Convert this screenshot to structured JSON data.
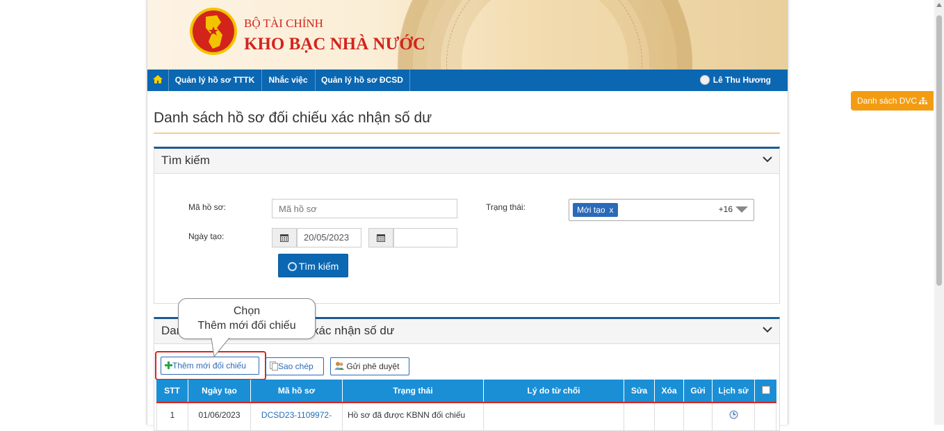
{
  "banner": {
    "ministry": "BỘ TÀI CHÍNH",
    "agency": "KHO BẠC NHÀ NƯỚC"
  },
  "nav": {
    "items": [
      {
        "label": "Quản lý hồ sơ TTTK"
      },
      {
        "label": "Nhắc việc"
      },
      {
        "label": "Quản lý hồ sơ ĐCSD"
      }
    ],
    "user": "Lê Thu Hương"
  },
  "page_title": "Danh sách hồ sơ đối chiếu xác nhận số dư",
  "search": {
    "panel_title": "Tìm kiếm",
    "code_label": "Mã hồ sơ:",
    "code_placeholder": "Mã hồ sơ",
    "status_label": "Trạng thái:",
    "status_tag": "Mới tạo",
    "status_tag_remove": "x",
    "status_more": "+16",
    "date_label": "Ngày tạo:",
    "date_from": "20/05/2023",
    "date_to": "",
    "search_button": "Tìm kiếm"
  },
  "list": {
    "panel_title": "Danh sách hồ sơ đối chiếu xác nhận số dư",
    "panel_title_visible_start": "Dan",
    "panel_title_visible_end": "xác nhận số dư",
    "buttons": {
      "add": "Thêm mới đối chiếu",
      "copy": "Sao chép",
      "send": "Gửi phê duyệt"
    },
    "columns": [
      "STT",
      "Ngày tạo",
      "Mã hồ sơ",
      "Trạng thái",
      "Lý do từ chối",
      "Sửa",
      "Xóa",
      "Gửi",
      "Lịch sử"
    ],
    "rows": [
      {
        "stt": "1",
        "date": "01/06/2023",
        "code": "DCSD23-1109972-",
        "status": "Hồ sơ đã được KBNN đối chiếu",
        "reason": ""
      }
    ]
  },
  "tooltip": {
    "line1": "Chọn",
    "line2": "Thêm mới đối chiếu"
  },
  "float_button": "Danh sách DVC",
  "colors": {
    "nav": "#0b67b2",
    "header": "#1a8fd6",
    "accent": "#f39c12",
    "highlight": "#d9231f"
  }
}
